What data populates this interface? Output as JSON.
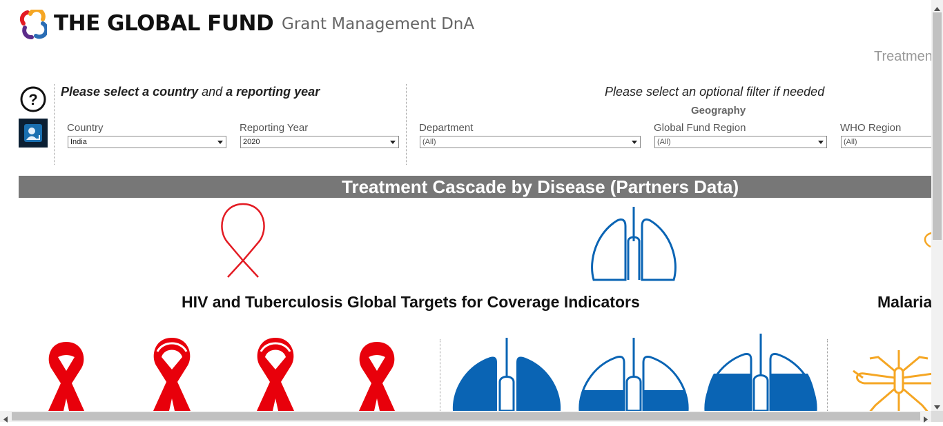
{
  "header": {
    "brand": "THE GLOBAL FUND",
    "subbrand": "Grant Management DnA",
    "top_right_text": "Treatmen"
  },
  "filters_left": {
    "prompt_bold_1": "Please select a country",
    "prompt_mid": " and ",
    "prompt_bold_2": "a reporting year",
    "country": {
      "label": "Country",
      "value": "India"
    },
    "year": {
      "label": "Reporting Year",
      "value": "2020"
    }
  },
  "filters_right": {
    "prompt": "Please select an optional filter if needed",
    "group_label": "Geography",
    "department": {
      "label": "Department",
      "value": "(All)"
    },
    "gf_region": {
      "label": "Global Fund Region",
      "value": "(All)"
    },
    "who_region": {
      "label": "WHO Region",
      "value": "(All)"
    }
  },
  "banner": {
    "title": "Treatment Cascade by Disease (Partners Data)"
  },
  "sections": {
    "hiv_tb_title": "HIV and Tuberculosis Global Targets for Coverage Indicators",
    "malaria_title": "Malaria"
  },
  "colors": {
    "hiv": "#e8000b",
    "tb": "#0a64b4",
    "malaria": "#f5a623",
    "banner": "#777777"
  },
  "icons": {
    "help": "question-circle-icon",
    "user": "user-portrait-icon",
    "hiv": "red-ribbon-icon",
    "tb": "lungs-icon",
    "malaria": "mosquito-icon"
  }
}
